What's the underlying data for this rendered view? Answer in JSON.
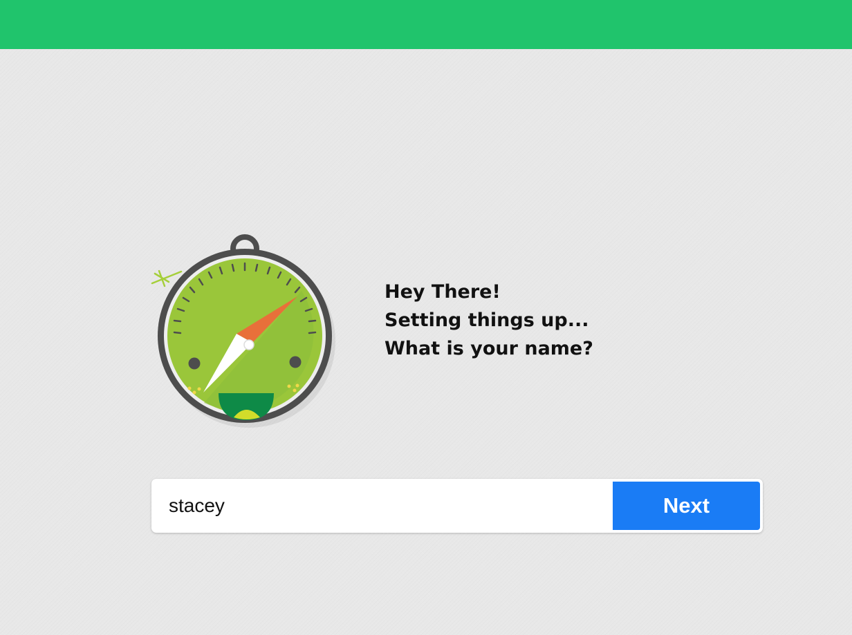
{
  "greeting": {
    "line1": "Hey There!",
    "line2": "Setting things up...",
    "line3": "What is your name?"
  },
  "name_form": {
    "input_value": "stacey",
    "next_label": "Next"
  },
  "colors": {
    "top_bar": "#20c46c",
    "background": "#e8e8e8",
    "next_button": "#1a7cf5",
    "text": "#111111"
  },
  "icons": {
    "mascot": "compass-mascot-icon"
  }
}
